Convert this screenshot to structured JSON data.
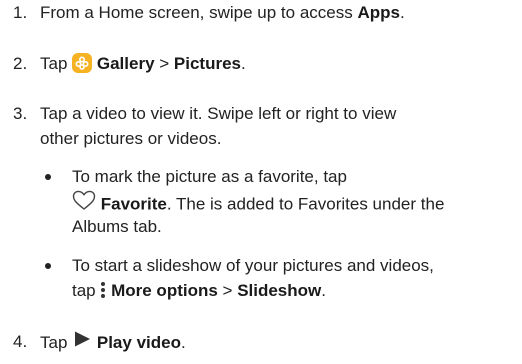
{
  "steps": [
    {
      "num": "1.",
      "pre": "From a Home screen, swipe up to access ",
      "bold": "Apps",
      "post": "."
    },
    {
      "num": "2.",
      "pre": "Tap ",
      "icon": "gallery-icon",
      "bold1": "Gallery",
      "sep": " > ",
      "bold2": "Pictures",
      "post": "."
    },
    {
      "num": "3.",
      "line1": "Tap a video to view it. Swipe left or right to view",
      "line2": "other pictures or videos."
    },
    {
      "num": "4.",
      "pre": "Tap ",
      "icon": "play-icon",
      "bold": "Play video",
      "post": "."
    }
  ],
  "bullets": [
    {
      "line1": "To mark the picture as a favorite, tap",
      "icon": "heart-icon",
      "bold": "Favorite",
      "line2_post": ". The is added to Favorites under the",
      "line3": "Albums tab."
    },
    {
      "line1": "To start a slideshow of your pictures and videos,",
      "pre2": "tap ",
      "icon": "more-options-icon",
      "bold1": "More options",
      "sep": " > ",
      "bold2": "Slideshow",
      "post": "."
    }
  ],
  "colors": {
    "gallery_icon_bg": "#f5b323",
    "text": "#222222",
    "play_icon": "#333333"
  }
}
